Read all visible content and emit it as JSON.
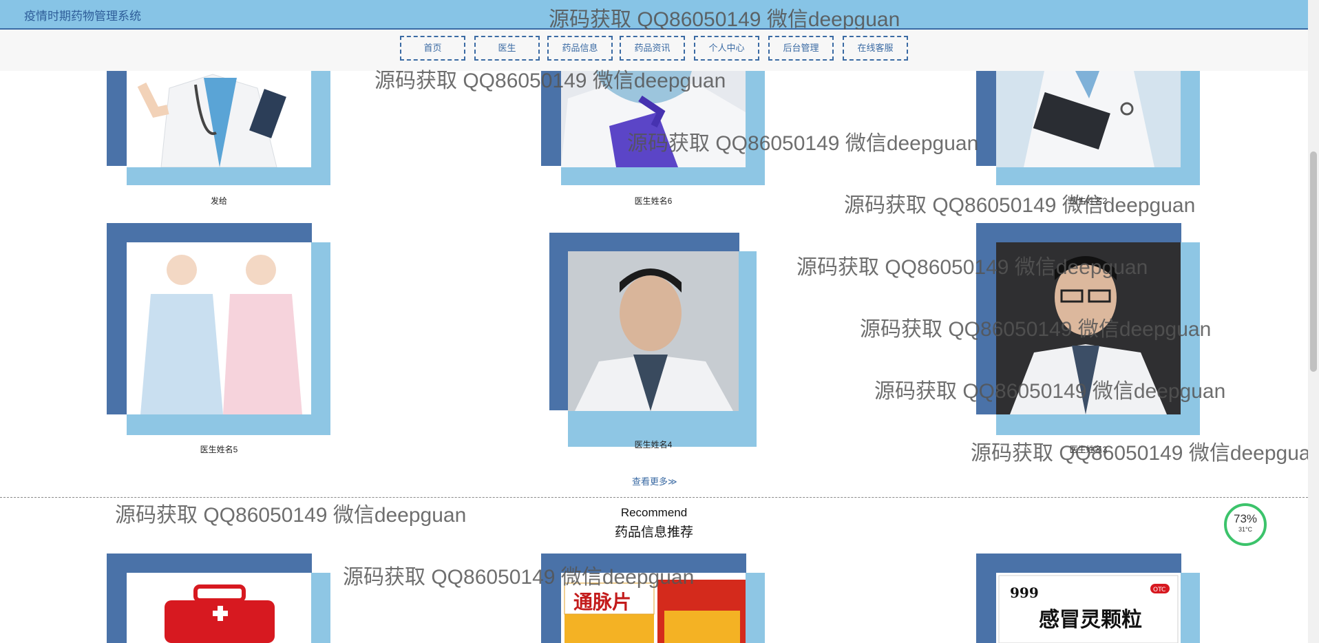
{
  "site_title": "疫情时期药物管理系统",
  "watermark": "源码获取 QQ86050149 微信deepguan",
  "nav": [
    "首页",
    "医生",
    "药品信息",
    "药品资讯",
    "个人中心",
    "后台管理",
    "在线客服"
  ],
  "doctors": [
    "发给",
    "医生姓名6",
    "医生姓名2",
    "医生姓名5",
    "医生姓名4",
    "医生姓名3"
  ],
  "more_label": "查看更多≫",
  "recommend": {
    "en": "Recommend",
    "cn": "药品信息推荐"
  },
  "temp_widget": {
    "percent": "73%",
    "temp": "31°C"
  },
  "colors": {
    "frame_dark": "#4a72a8",
    "frame_light": "#8ec6e4",
    "topbar": "#87c4e6"
  },
  "medicine_labels": {
    "tongmai": "通脉片",
    "ganmao": "感冒灵颗粒",
    "brand": "999",
    "otc": "OTC"
  }
}
